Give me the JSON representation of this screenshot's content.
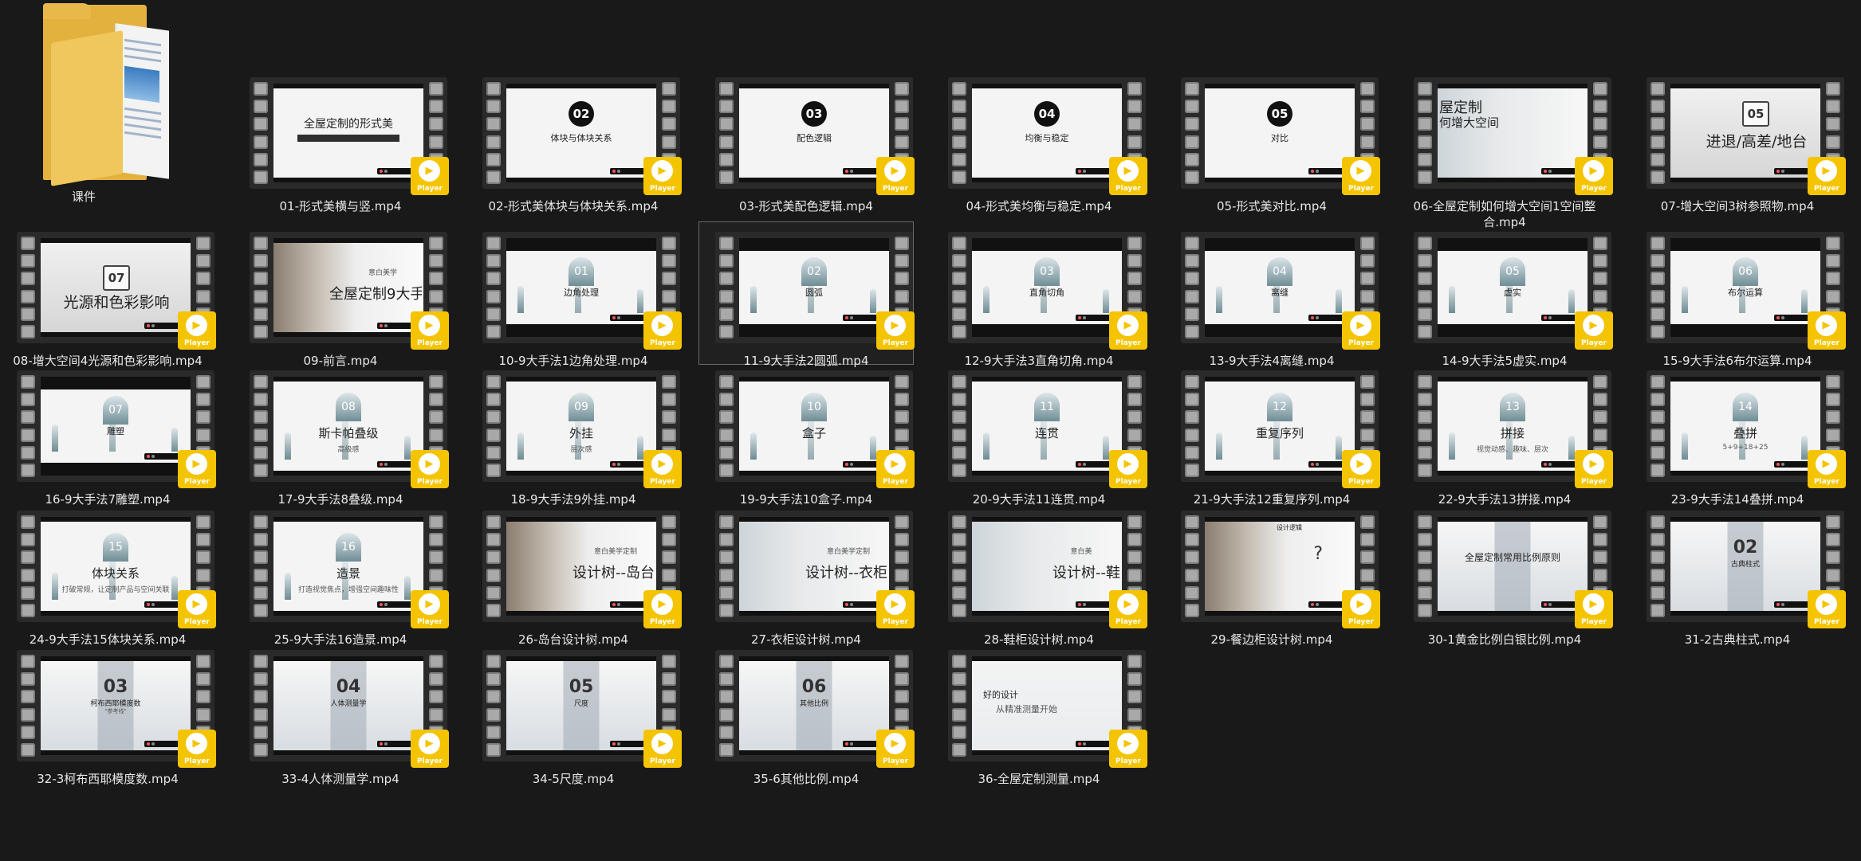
{
  "folder": {
    "label": "课件",
    "icon": "folder-icon"
  },
  "player_label": "Player",
  "colors": {
    "background": "#191919",
    "player_badge": "#f5c400",
    "film_reel": "#2a2a2a",
    "selection_border": "#6a6a6a"
  },
  "videos": [
    {
      "caption": "01-形式美横与竖.mp4",
      "style": "plain",
      "line1": "全屋定制的形式美",
      "line2": "",
      "badge": ""
    },
    {
      "caption": "02-形式美体块与体块关系.mp4",
      "style": "circle",
      "badge": "02",
      "line1": "体块与体块关系",
      "line2": ""
    },
    {
      "caption": "03-形式美配色逻辑.mp4",
      "style": "circle",
      "badge": "03",
      "line1": "配色逻辑",
      "line2": ""
    },
    {
      "caption": "04-形式美均衡与稳定.mp4",
      "style": "circle",
      "badge": "04",
      "line1": "均衡与稳定",
      "line2": ""
    },
    {
      "caption": "05-形式美对比.mp4",
      "style": "circle",
      "badge": "05",
      "line1": "对比",
      "line2": ""
    },
    {
      "caption": "06-全屋定制如何增大空间1空间整合.mp4",
      "style": "room",
      "badge": "",
      "line1": "屋定制",
      "line2": "何增大空间"
    },
    {
      "caption": "07-增大空间3树参照物.mp4",
      "style": "square",
      "badge": "05",
      "line1": "进退/高差/地台",
      "line2": ""
    },
    {
      "caption": "08-增大空间4光源和色彩影响.mp4",
      "style": "square",
      "badge": "07",
      "line1": "光源和色彩影响",
      "line2": ""
    },
    {
      "caption": "09-前言.mp4",
      "style": "photo",
      "badge": "",
      "line1": "全屋定制9大手",
      "line2": "意白美学"
    },
    {
      "caption": "10-9大手法1边角处理.mp4",
      "style": "arch-letter",
      "badge": "01",
      "line1": "边角处理",
      "line2": ""
    },
    {
      "caption": "11-9大手法2圆弧.mp4",
      "style": "arch-letter",
      "badge": "02",
      "line1": "圆弧",
      "line2": "",
      "selected": true
    },
    {
      "caption": "12-9大手法3直角切角.mp4",
      "style": "arch-letter",
      "badge": "03",
      "line1": "直角切角",
      "line2": ""
    },
    {
      "caption": "13-9大手法4离缝.mp4",
      "style": "arch-letter",
      "badge": "04",
      "line1": "离缝",
      "line2": ""
    },
    {
      "caption": "14-9大手法5虚实.mp4",
      "style": "arch-letter",
      "badge": "05",
      "line1": "虚实",
      "line2": ""
    },
    {
      "caption": "15-9大手法6布尔运算.mp4",
      "style": "arch-letter",
      "badge": "06",
      "line1": "布尔运算",
      "line2": ""
    },
    {
      "caption": "16-9大手法7雕塑.mp4",
      "style": "arch-letter",
      "badge": "07",
      "line1": "雕塑",
      "line2": ""
    },
    {
      "caption": "17-9大手法8叠级.mp4",
      "style": "arch",
      "badge": "08",
      "line1": "斯卡帕叠级",
      "line2": "高级感"
    },
    {
      "caption": "18-9大手法9外挂.mp4",
      "style": "arch",
      "badge": "09",
      "line1": "外挂",
      "line2": "层次感"
    },
    {
      "caption": "19-9大手法10盒子.mp4",
      "style": "arch",
      "badge": "10",
      "line1": "盒子",
      "line2": ""
    },
    {
      "caption": "20-9大手法11连贯.mp4",
      "style": "arch",
      "badge": "11",
      "line1": "连贯",
      "line2": ""
    },
    {
      "caption": "21-9大手法12重复序列.mp4",
      "style": "arch",
      "badge": "12",
      "line1": "重复序列",
      "line2": ""
    },
    {
      "caption": "22-9大手法13拼接.mp4",
      "style": "arch",
      "badge": "13",
      "line1": "拼接",
      "line2": "视觉动感、趣味、层次"
    },
    {
      "caption": "23-9大手法14叠拼.mp4",
      "style": "arch",
      "badge": "14",
      "line1": "叠拼",
      "line2": "5+9+18+25"
    },
    {
      "caption": "24-9大手法15体块关系.mp4",
      "style": "arch",
      "badge": "15",
      "line1": "体块关系",
      "line2": "打破常规，让定制产品与空间关联"
    },
    {
      "caption": "25-9大手法16造景.mp4",
      "style": "arch",
      "badge": "16",
      "line1": "造景",
      "line2": "打造视觉焦点，增强空间趣味性"
    },
    {
      "caption": "26-岛台设计树.mp4",
      "style": "photo",
      "badge": "",
      "line1": "设计树--岛台",
      "line2": "意白美学定制"
    },
    {
      "caption": "27-衣柜设计树.mp4",
      "style": "room",
      "badge": "",
      "line1": "设计树--衣柜",
      "line2": "意白美学定制"
    },
    {
      "caption": "28-鞋柜设计树.mp4",
      "style": "room",
      "badge": "",
      "line1": "设计树--鞋",
      "line2": "意白美"
    },
    {
      "caption": "29-餐边柜设计树.mp4",
      "style": "photo-q",
      "badge": "",
      "line1": "设计逻辑",
      "line2": "?"
    },
    {
      "caption": "30-1黄金比例白银比例.mp4",
      "style": "building",
      "badge": "",
      "line1": "全屋定制常用比例原则",
      "line2": ""
    },
    {
      "caption": "31-2古典柱式.mp4",
      "style": "building",
      "badge": "02",
      "line1": "古典柱式",
      "line2": ""
    },
    {
      "caption": "32-3柯布西耶模度数.mp4",
      "style": "building",
      "badge": "03",
      "line1": "柯布西耶模度数",
      "line2": "\"参考线\""
    },
    {
      "caption": "33-4人体测量学.mp4",
      "style": "building",
      "badge": "04",
      "line1": "人体测量学",
      "line2": ""
    },
    {
      "caption": "34-5尺度.mp4",
      "style": "building",
      "badge": "05",
      "line1": "尺度",
      "line2": ""
    },
    {
      "caption": "35-6其他比例.mp4",
      "style": "building",
      "badge": "06",
      "line1": "其他比例",
      "line2": ""
    },
    {
      "caption": "36-全屋定制测量.mp4",
      "style": "measure",
      "badge": "",
      "line1": "好的设计",
      "line2": "从精准测量开始"
    }
  ]
}
